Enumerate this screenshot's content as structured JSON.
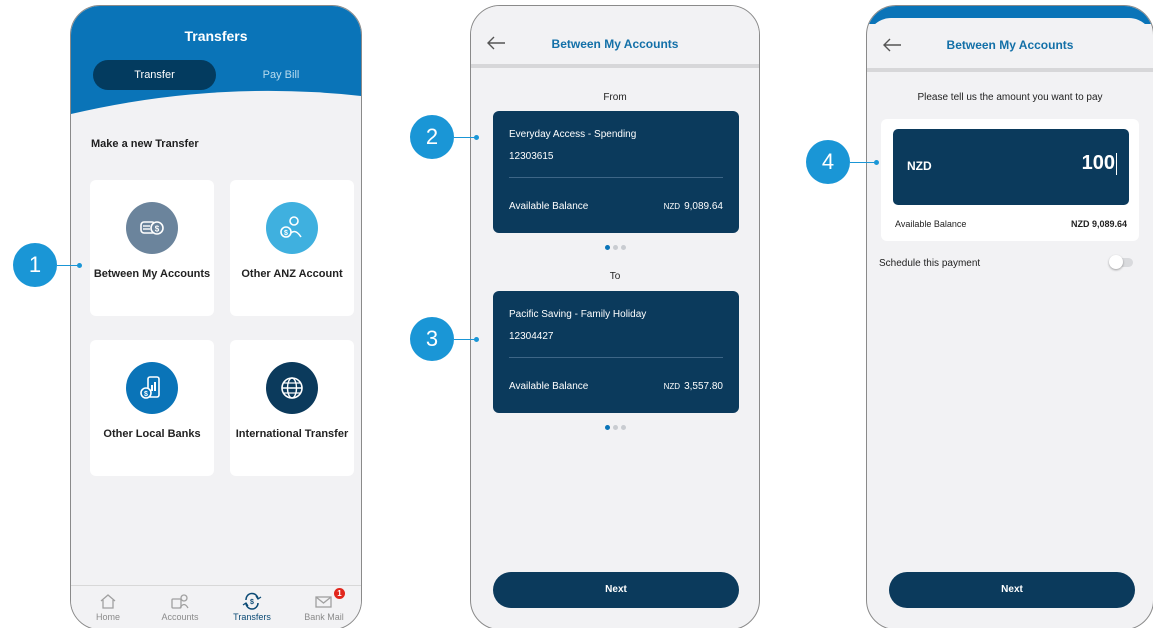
{
  "callouts": [
    "1",
    "2",
    "3",
    "4"
  ],
  "screen1": {
    "title": "Transfers",
    "tabs": [
      {
        "label": "Transfer",
        "active": true
      },
      {
        "label": "Pay Bill",
        "active": false
      }
    ],
    "section_title": "Make a new Transfer",
    "options": [
      {
        "label": "Between My Accounts",
        "icon": "coins-icon",
        "color": "#6b849c"
      },
      {
        "label": "Other ANZ Account",
        "icon": "person-dollar-icon",
        "color": "#3fb0df"
      },
      {
        "label": "Other Local Banks",
        "icon": "phone-dollar-icon",
        "color": "#0a74b8"
      },
      {
        "label": "International Transfer",
        "icon": "globe-icon",
        "color": "#0b3a5c"
      }
    ],
    "nav": [
      {
        "label": "Home",
        "icon": "home-icon"
      },
      {
        "label": "Accounts",
        "icon": "accounts-icon"
      },
      {
        "label": "Transfers",
        "icon": "transfers-icon",
        "active": true
      },
      {
        "label": "Bank Mail",
        "icon": "mail-icon",
        "badge": "1"
      }
    ]
  },
  "screen2": {
    "title": "Between My Accounts",
    "from_label": "From",
    "to_label": "To",
    "from_account": {
      "name": "Everyday Access - Spending",
      "number": "12303615",
      "balance_label": "Available Balance",
      "currency": "NZD",
      "balance": "9,089.64"
    },
    "to_account": {
      "name": "Pacific Saving - Family Holiday",
      "number": "12304427",
      "balance_label": "Available Balance",
      "currency": "NZD",
      "balance": "3,557.80"
    },
    "next_label": "Next"
  },
  "screen3": {
    "title": "Between My Accounts",
    "prompt": "Please tell us the amount you want to pay",
    "currency": "NZD",
    "amount": "100",
    "available_label": "Available Balance",
    "available_value": "NZD 9,089.64",
    "schedule_label": "Schedule this payment",
    "schedule_on": false,
    "next_label": "Next"
  },
  "colors": {
    "brand_blue": "#0a74b8",
    "navy": "#0b3a5c",
    "callout_blue": "#1a96d6"
  }
}
